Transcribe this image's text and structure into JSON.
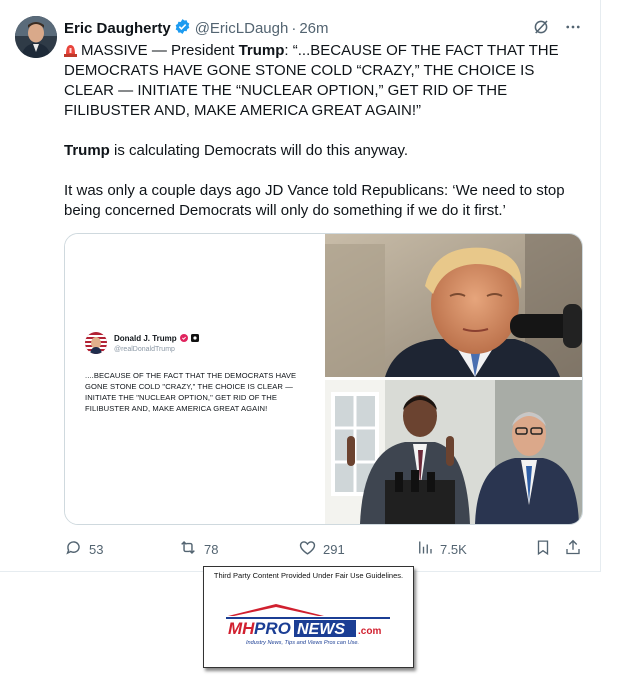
{
  "tweet": {
    "author_name": "Eric Daugherty",
    "handle": "@EricLDaugh",
    "separator": "·",
    "time": "26m",
    "line1_prefix": "MASSIVE — President ",
    "line1_bold": "Trump",
    "line1_rest": ": “...BECAUSE OF THE FACT THAT THE DEMOCRATS HAVE GONE STONE COLD “CRAZY,” THE CHOICE IS CLEAR — INITIATE THE “NUCLEAR OPTION,” GET RID OF THE FILIBUSTER AND, MAKE AMERICA GREAT AGAIN!”",
    "line2_bold": "Trump",
    "line2_rest": " is calculating Democrats will do this anyway.",
    "line3": "It was only a couple days ago JD Vance told Republicans: ‘We need to stop being concerned Democrats will only do something if we do it first.’"
  },
  "embedded_post": {
    "name": "Donald J. Trump",
    "handle": "@realDonaldTrump",
    "text": "....BECAUSE OF THE FACT THAT THE DEMOCRATS HAVE GONE STONE COLD \"CRAZY,\" THE CHOICE IS CLEAR — INITIATE THE \"NUCLEAR OPTION,\" GET RID OF THE FILIBUSTER AND, MAKE AMERICA GREAT AGAIN!"
  },
  "actions": {
    "replies": "53",
    "reposts": "78",
    "likes": "291",
    "views": "7.5K"
  },
  "fair_use": {
    "label": "Third Party Content Provided Under Fair Use Guidelines.",
    "logo_mh": "MH",
    "logo_pro": "PRO",
    "logo_news": "NEWS",
    "logo_com": ".com",
    "tagline": "Industry News, Tips and Views Pros can Use."
  },
  "colors": {
    "verified_blue": "#1d9bf0",
    "muted": "#536471",
    "logo_red": "#d1202f",
    "logo_blue": "#1b3e94"
  }
}
